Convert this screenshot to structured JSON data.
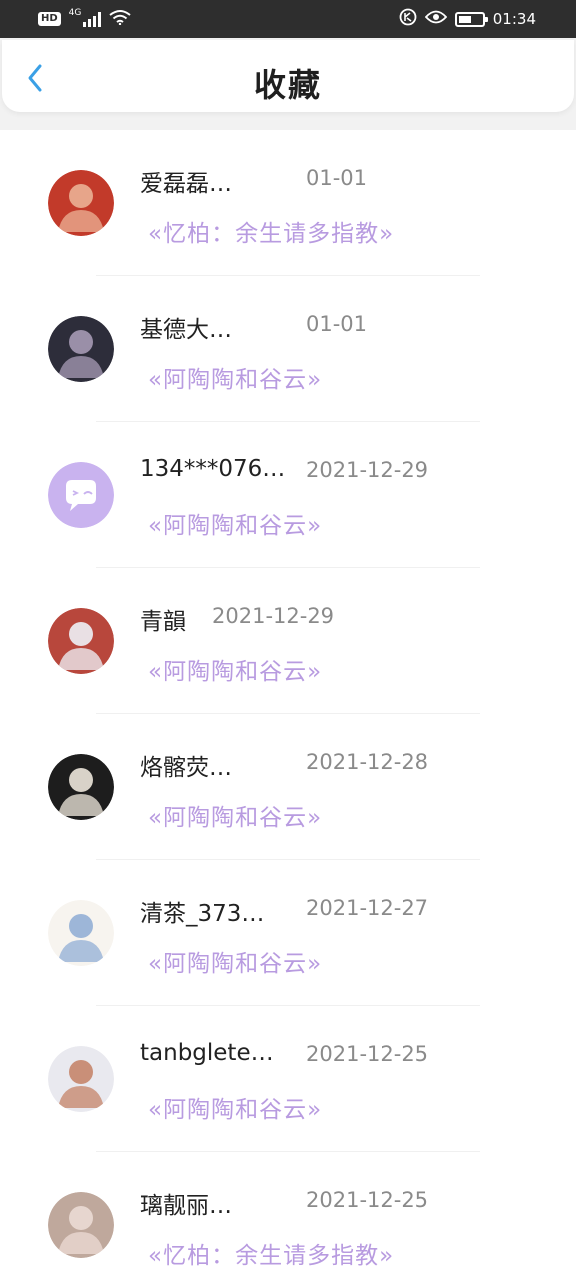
{
  "status_bar": {
    "hd": "HD",
    "network": "4G",
    "time": "01:34",
    "battery_level": 0.55
  },
  "header": {
    "title": "收藏",
    "back_icon": "chevron-left-icon",
    "accent": "#3aa0e6"
  },
  "favorites": [
    {
      "name": "爱磊磊…",
      "date": "01-01",
      "book": "«忆柏：余生请多指教»",
      "avatar_colors": [
        "#c23a2a",
        "#e7a58a"
      ]
    },
    {
      "name": "基德大…",
      "date": "01-01",
      "book": "«阿陶陶和谷云»",
      "avatar_colors": [
        "#2d2d3a",
        "#9a8fa8"
      ]
    },
    {
      "name": "134***076…",
      "date": "2021-12-29",
      "book": "«阿陶陶和谷云»",
      "avatar_colors": [
        "#c9b3ef",
        "#ffffff"
      ]
    },
    {
      "name": "青韻",
      "date": "2021-12-29",
      "book": "«阿陶陶和谷云»",
      "avatar_colors": [
        "#b8473c",
        "#e9e0e4"
      ]
    },
    {
      "name": "烙髂荧…",
      "date": "2021-12-28",
      "book": "«阿陶陶和谷云»",
      "avatar_colors": [
        "#1d1d1d",
        "#d8d2c8"
      ]
    },
    {
      "name": "清茶_373…",
      "date": "2021-12-27",
      "book": "«阿陶陶和谷云»",
      "avatar_colors": [
        "#f7f4ef",
        "#9db6d8"
      ]
    },
    {
      "name": "tanbglete…",
      "date": "2021-12-25",
      "book": "«阿陶陶和谷云»",
      "avatar_colors": [
        "#e9e9ef",
        "#c98f78"
      ]
    },
    {
      "name": "璃靓丽…",
      "date": "2021-12-25",
      "book": "«忆柏：余生请多指教»",
      "avatar_colors": [
        "#bfa89c",
        "#e7d6cf"
      ]
    }
  ],
  "colors": {
    "book_title": "#b89be0",
    "date": "#8a8a8a"
  }
}
